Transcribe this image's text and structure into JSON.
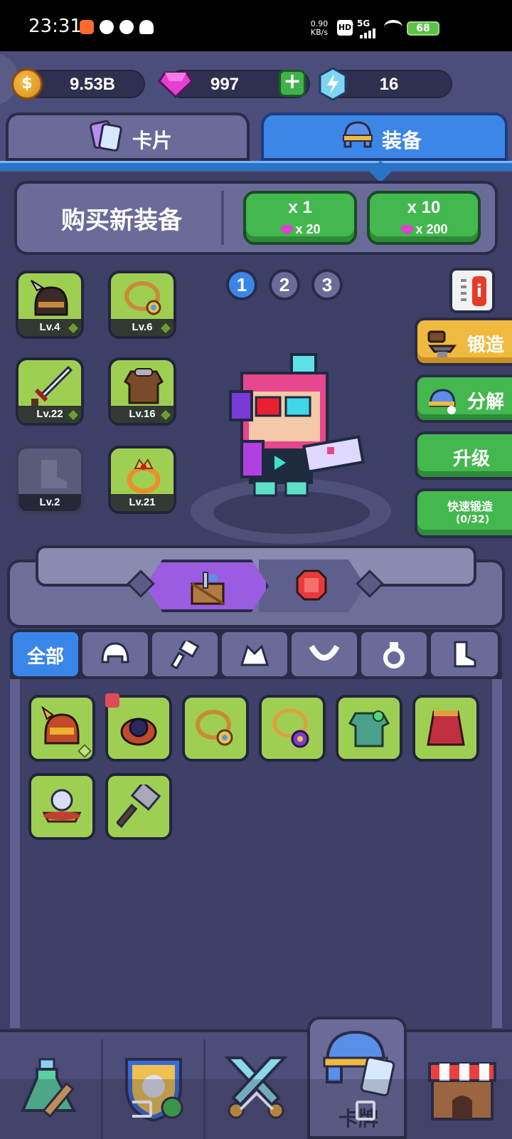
{
  "status_bar": {
    "time": "23:31",
    "network_speed": "0.90\nKB/s",
    "hd": "HD",
    "signal": "5G",
    "battery": "68"
  },
  "currency": {
    "gold": "9.53B",
    "gems": "997",
    "energy": "16"
  },
  "tabs": [
    {
      "label": "卡片",
      "active": false
    },
    {
      "label": "装备",
      "active": true
    }
  ],
  "buy_panel": {
    "title": "购买新装备",
    "options": [
      {
        "qty": "x 1",
        "cost": "x 20"
      },
      {
        "qty": "x 10",
        "cost": "x 200"
      }
    ]
  },
  "equipped": [
    {
      "slot": "helmet",
      "level": "Lv.4"
    },
    {
      "slot": "necklace",
      "level": "Lv.6"
    },
    {
      "slot": "weapon",
      "level": "Lv.22"
    },
    {
      "slot": "armor",
      "level": "Lv.16"
    },
    {
      "slot": "boots",
      "level": "Lv.2",
      "empty": true
    },
    {
      "slot": "ring",
      "level": "Lv.21"
    }
  ],
  "pages": [
    "1",
    "2",
    "3"
  ],
  "active_page": "1",
  "side_buttons": {
    "forge": "锻造",
    "salvage": "分解",
    "upgrade": "升级",
    "quick_forge": "快速锻造",
    "quick_forge_count": "(0/32)"
  },
  "filter_tabs": {
    "all": "全部",
    "icons": [
      "helmet-icon",
      "weapon-icon",
      "armor-icon",
      "necklace-icon",
      "ring-icon",
      "boots-icon"
    ]
  },
  "inventory": [
    {
      "name": "horned-helmet"
    },
    {
      "name": "dark-ring",
      "locked": true
    },
    {
      "name": "gold-necklace"
    },
    {
      "name": "purple-amulet"
    },
    {
      "name": "green-armor"
    },
    {
      "name": "red-cape"
    },
    {
      "name": "pearl-crown"
    },
    {
      "name": "war-hammer"
    }
  ],
  "bottom_nav": {
    "active": "cards",
    "active_label": "卡牌",
    "items": [
      "potion",
      "guild",
      "battle",
      "cards",
      "shop"
    ]
  },
  "colors": {
    "background": "#3d3f66",
    "accent_blue": "#3c86e8",
    "green_button": "#43b84e",
    "gold_button": "#f0b93f",
    "item_bg": "#9fcf52"
  }
}
